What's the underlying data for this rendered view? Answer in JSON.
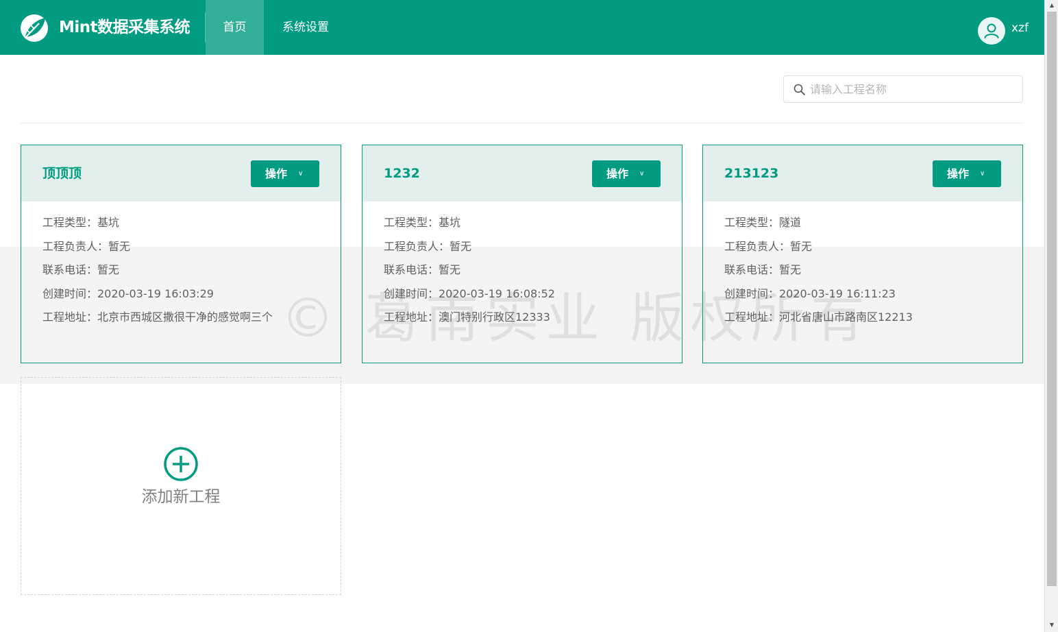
{
  "app": {
    "title": "Mint数据采集系统"
  },
  "nav": {
    "items": [
      {
        "label": "首页",
        "active": true
      },
      {
        "label": "系统设置",
        "active": false
      }
    ]
  },
  "user": {
    "name": "xzf"
  },
  "search": {
    "placeholder": "请输入工程名称",
    "value": ""
  },
  "projects": [
    {
      "title": "顶顶顶",
      "action_label": "操作",
      "rows": [
        "工程类型：基坑",
        "工程负责人：暂无",
        "联系电话：暂无",
        "创建时间：2020-03-19 16:03:29",
        "工程地址：北京市西城区撒很干净的感觉啊三个"
      ]
    },
    {
      "title": "1232",
      "action_label": "操作",
      "rows": [
        "工程类型：基坑",
        "工程负责人：暂无",
        "联系电话：暂无",
        "创建时间：2020-03-19 16:08:52",
        "工程地址：澳门特别行政区12333"
      ]
    },
    {
      "title": "213123",
      "action_label": "操作",
      "rows": [
        "工程类型：隧道",
        "工程负责人：暂无",
        "联系电话：暂无",
        "创建时间：2020-03-19 16:11:23",
        "工程地址：河北省唐山市路南区12213"
      ]
    }
  ],
  "add_project": {
    "label": "添加新工程"
  },
  "watermark": {
    "text": "© 葛南实业 版权所有"
  },
  "colors": {
    "brand": "#009b80",
    "card_header": "#e3efed"
  },
  "icons": {
    "logo": "leaf-logo-icon",
    "user": "user-icon",
    "search": "search-icon",
    "dropdown": "chevron-down-icon",
    "add": "plus-circle-icon"
  }
}
